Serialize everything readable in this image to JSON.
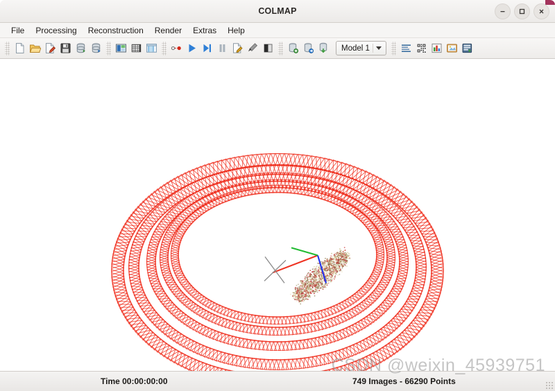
{
  "window": {
    "title": "COLMAP",
    "controls": [
      {
        "name": "minimize-button",
        "glyph": "–"
      },
      {
        "name": "maximize-button",
        "glyph": "□"
      },
      {
        "name": "close-button",
        "glyph": "✕"
      }
    ]
  },
  "menubar": {
    "items": [
      {
        "label": "File"
      },
      {
        "label": "Processing"
      },
      {
        "label": "Reconstruction"
      },
      {
        "label": "Render"
      },
      {
        "label": "Extras"
      },
      {
        "label": "Help"
      }
    ]
  },
  "toolbar": {
    "groups": [
      {
        "buttons": [
          {
            "icon": "new-project-icon",
            "label": "New project"
          },
          {
            "icon": "open-project-icon",
            "label": "Open project"
          },
          {
            "icon": "edit-project-icon",
            "label": "Edit project"
          },
          {
            "icon": "save-project-icon",
            "label": "Save project"
          },
          {
            "icon": "import-model-icon",
            "label": "Import model"
          },
          {
            "icon": "export-model-icon",
            "label": "Export model"
          }
        ]
      },
      {
        "buttons": [
          {
            "icon": "feature-extraction-icon",
            "label": "Feature extraction"
          },
          {
            "icon": "feature-matching-icon",
            "label": "Feature matching"
          },
          {
            "icon": "database-management-icon",
            "label": "Database management"
          }
        ]
      },
      {
        "buttons": [
          {
            "icon": "automatic-reconstruction-icon",
            "label": "Automatic reconstruction"
          },
          {
            "icon": "start-reconstruction-icon",
            "label": "Start reconstruction"
          },
          {
            "icon": "step-reconstruction-icon",
            "label": "Reconstruct next image"
          },
          {
            "icon": "pause-reconstruction-icon",
            "label": "Pause reconstruction"
          },
          {
            "icon": "bundle-adjustment-icon",
            "label": "Bundle adjustment"
          },
          {
            "icon": "dense-reconstruction-icon",
            "label": "Dense reconstruction"
          },
          {
            "icon": "render-options-icon",
            "label": "Render options"
          }
        ]
      },
      {
        "buttons": [
          {
            "icon": "add-model-icon",
            "label": "Add model"
          },
          {
            "icon": "merge-models-icon",
            "label": "Merge models"
          },
          {
            "icon": "save-model-icon",
            "label": "Save model"
          }
        ]
      }
    ],
    "model_selector": {
      "name": "model-selector",
      "value": "Model 1"
    },
    "right_group": {
      "buttons": [
        {
          "icon": "log-panel-icon",
          "label": "Show log"
        },
        {
          "icon": "grab-image-icon",
          "label": "Grab image"
        },
        {
          "icon": "statistics-icon",
          "label": "Show model statistics"
        },
        {
          "icon": "grab-movie-icon",
          "label": "Grab movie"
        },
        {
          "icon": "undistort-icon",
          "label": "Undistortion"
        }
      ]
    }
  },
  "viewport": {
    "name": "model-viewer",
    "background_color": "#ffffff",
    "frustum_color": "#ee2211",
    "axes": [
      {
        "name": "axis-x",
        "color": "#ee3322"
      },
      {
        "name": "axis-y",
        "color": "#22bb33"
      },
      {
        "name": "axis-z",
        "color": "#2233ee"
      }
    ],
    "gizmo_color": "#888888",
    "point_cloud_colors": [
      "#c9b98a",
      "#d8cfa2",
      "#b03030",
      "#e8dcb8",
      "#8a7a52",
      "#cc3333",
      "#9c8f66"
    ]
  },
  "statusbar": {
    "time_label": "Time 00:00:00:00",
    "stats_label": "749 Images - 66290 Points"
  },
  "watermark": {
    "text": "CSDN @weixin_45939751"
  }
}
